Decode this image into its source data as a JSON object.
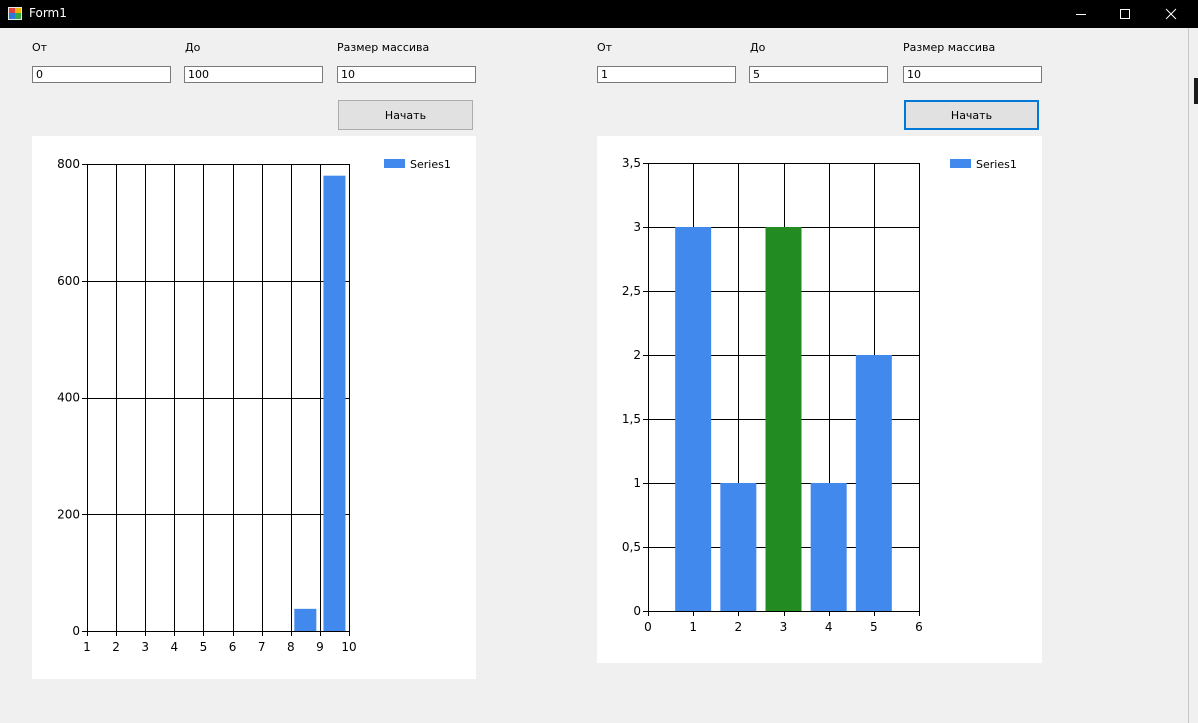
{
  "window": {
    "title": "Form1",
    "controls": {
      "minimize": "minimize-icon",
      "maximize": "maximize-icon",
      "close": "close-icon"
    }
  },
  "left": {
    "from_label": "От",
    "to_label": "До",
    "size_label": "Размер массива",
    "from_value": "0",
    "to_value": "100",
    "size_value": "10",
    "start_label": "Начать"
  },
  "right": {
    "from_label": "От",
    "to_label": "До",
    "size_label": "Размер массива",
    "from_value": "1",
    "to_value": "5",
    "size_value": "10",
    "start_label": "Начать"
  },
  "colors": {
    "series": "#4189ed",
    "highlight": "#228b22",
    "focus_border": "#0078d7"
  },
  "chart_data": [
    {
      "type": "bar",
      "x": [
        8,
        9
      ],
      "values": [
        38,
        780
      ],
      "series_name": "Series1",
      "xlim": [
        1,
        10
      ],
      "ylim": [
        0,
        800
      ],
      "xticks": [
        "1",
        "2",
        "3",
        "4",
        "5",
        "6",
        "7",
        "8",
        "9",
        "10"
      ],
      "yticks": [
        "0",
        "200",
        "400",
        "600",
        "800"
      ],
      "grid": true,
      "legend": "top-right",
      "highlight_index": -1
    },
    {
      "type": "bar",
      "x": [
        1,
        2,
        3,
        4,
        5
      ],
      "values": [
        3,
        1,
        3,
        1,
        2
      ],
      "series_name": "Series1",
      "xlim": [
        0,
        6
      ],
      "ylim": [
        0,
        3.5
      ],
      "xticks": [
        "0",
        "1",
        "2",
        "3",
        "4",
        "5",
        "6"
      ],
      "yticks": [
        "0",
        "0,5",
        "1",
        "1,5",
        "2",
        "2,5",
        "3",
        "3,5"
      ],
      "grid": true,
      "legend": "top-right",
      "highlight_index": 2
    }
  ]
}
